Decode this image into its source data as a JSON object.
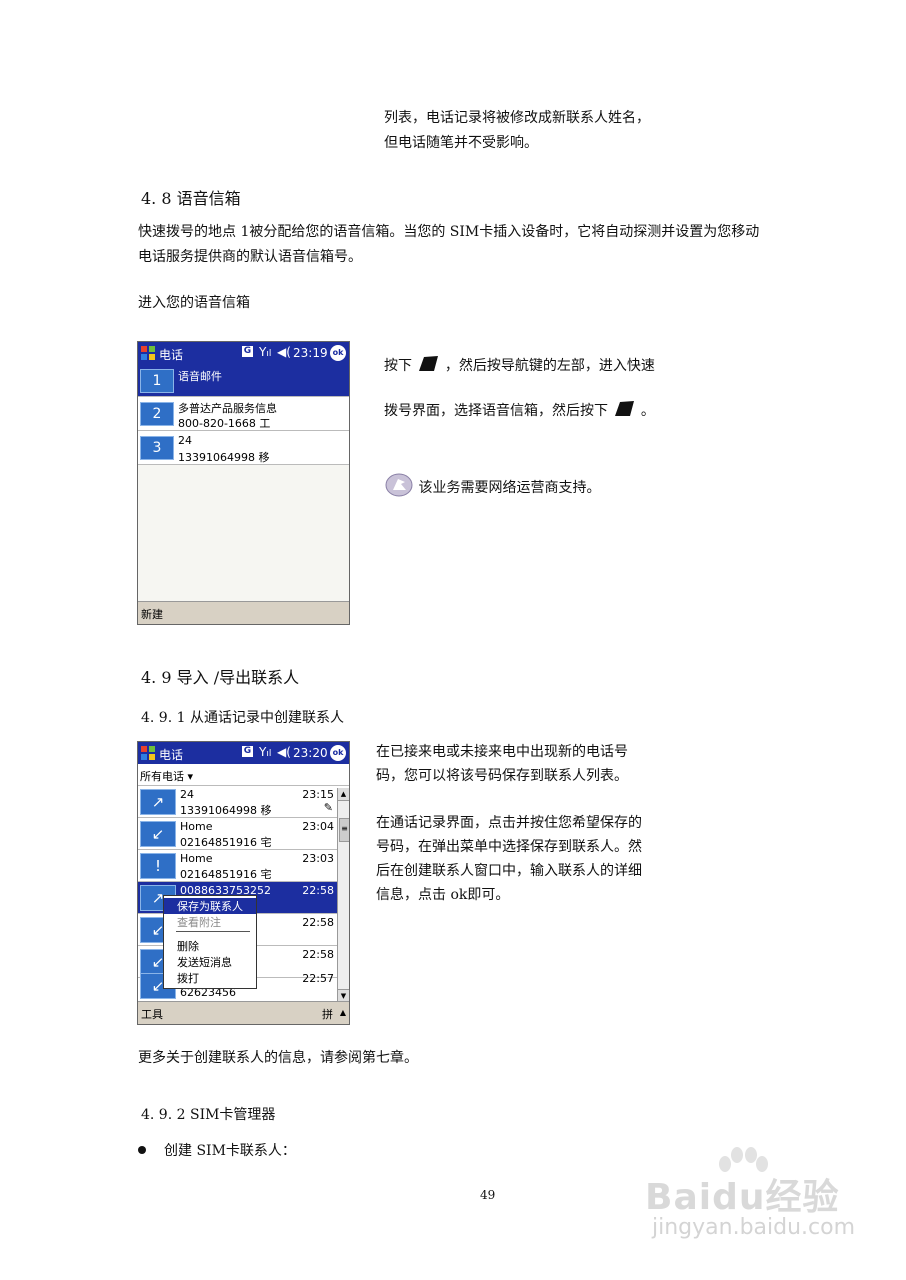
{
  "top_note": {
    "line1": "列表，电话记录将被修改成新联系人姓名，",
    "line2": "但电话随笔并不受影响。"
  },
  "sec_4_8": {
    "heading": "4. 8 语音信箱",
    "para_line1": "快速拨号的地点  1被分配给您的语音信箱。当您的  SIM卡插入设备时，它将自动探测并设置为您移动",
    "para_line2": "电话服务提供商的默认语音信箱号。",
    "sub": "进入您的语音信箱",
    "side_line1a": "按下",
    "side_line1b": "，然后按导航键的左部，进入快速",
    "side_line2a": "拨号界面，选择语音信箱，然后按下",
    "side_line2b": "。",
    "note": "该业务需要网络运营商支持。"
  },
  "phone1": {
    "app": "电话",
    "g": "G",
    "time": "23:19",
    "ok": "ok",
    "rows": [
      {
        "num": "1",
        "l1": "语音邮件",
        "l2": ""
      },
      {
        "num": "2",
        "l1": "多普达产品服务信息",
        "l2": "800-820-1668 工"
      },
      {
        "num": "3",
        "l1": "24",
        "l2": "13391064998 移"
      }
    ],
    "bottom_left": "新建"
  },
  "sec_4_9": {
    "heading": "4. 9 导入 /导出联系人",
    "sub1": "4. 9. 1 从通话记录中创建联系人",
    "p1_line1": "在已接来电或未接来电中出现新的电话号",
    "p1_line2": "码，您可以将该号码保存到联系人列表。",
    "p2_line1": "在通话记录界面，点击并按住您希望保存的",
    "p2_line2": "号码，在弹出菜单中选择保存到联系人。然",
    "p2_line3": "后在创建联系人窗口中，输入联系人的详细",
    "p2_line4": "信息，点击  ok即可。",
    "more": "更多关于创建联系人的信息，请参阅第七章。",
    "sub2": "4. 9. 2 SIM卡管理器",
    "bullet": "创建  SIM卡联系人："
  },
  "phone2": {
    "app": "电话",
    "g": "G",
    "time": "23:20",
    "ok": "ok",
    "filter": "所有电话 ▾",
    "rows": [
      {
        "name": "24",
        "num": "13391064998 移",
        "time": "23:15",
        "icon": "↗"
      },
      {
        "name": "Home",
        "num": "02164851916 宅",
        "time": "23:04",
        "icon": "↙"
      },
      {
        "name": "Home",
        "num": "02164851916 宅",
        "time": "23:03",
        "icon": "!"
      },
      {
        "name": "0088633753252",
        "num": "",
        "time": "22:58",
        "icon": "↗"
      },
      {
        "name": "",
        "num": "",
        "time": "22:58",
        "icon": "↙"
      },
      {
        "name": "",
        "num": "",
        "time": "22:58",
        "icon": "↙"
      },
      {
        "name": "",
        "num": "62623456",
        "time": "22:57",
        "icon": "↙"
      }
    ],
    "menu": {
      "save": "保存为联系人",
      "view_note": "查看附注",
      "delete": "删除",
      "sms": "发送短消息",
      "dial": "拨打"
    },
    "bottom_left": "工具",
    "bottom_right": "拼"
  },
  "page_number": "49",
  "watermark": {
    "brand": "Baidu经验",
    "url": "jingyan.baidu.com"
  }
}
